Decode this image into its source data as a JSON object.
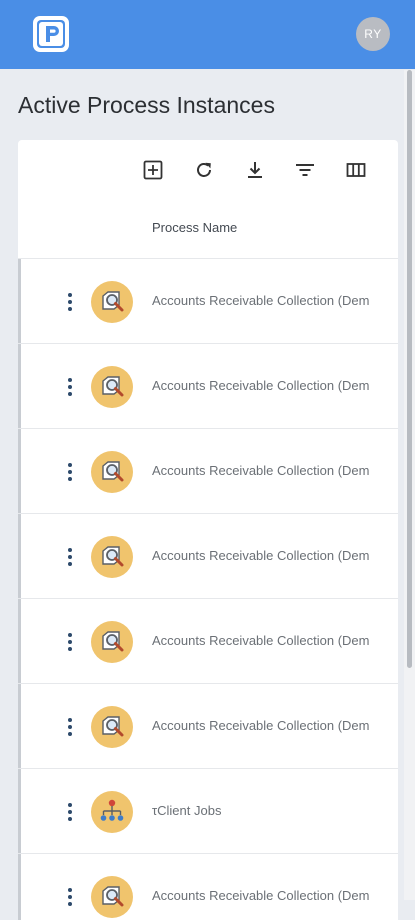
{
  "app": {
    "logo_icon": "p-logo-icon",
    "avatar_initials": "RY",
    "brand_color": "#4a8ee6"
  },
  "page": {
    "title": "Active Process Instances"
  },
  "toolbar": {
    "buttons": [
      {
        "name": "add-icon"
      },
      {
        "name": "refresh-icon"
      },
      {
        "name": "download-icon"
      },
      {
        "name": "filter-icon"
      },
      {
        "name": "columns-icon"
      }
    ]
  },
  "table": {
    "column_header": "Process Name",
    "rows": [
      {
        "label": "Accounts Receivable Collection (Dem",
        "icon": "magnifier-document-icon"
      },
      {
        "label": "Accounts Receivable Collection (Dem",
        "icon": "magnifier-document-icon"
      },
      {
        "label": "Accounts Receivable Collection (Dem",
        "icon": "magnifier-document-icon"
      },
      {
        "label": "Accounts Receivable Collection (Dem",
        "icon": "magnifier-document-icon"
      },
      {
        "label": "Accounts Receivable Collection (Dem",
        "icon": "magnifier-document-icon"
      },
      {
        "label": "Accounts Receivable Collection (Dem",
        "icon": "magnifier-document-icon"
      },
      {
        "label": "τClient Jobs",
        "icon": "org-chart-icon"
      },
      {
        "label": "Accounts Receivable Collection (Dem",
        "icon": "magnifier-document-icon"
      }
    ]
  }
}
